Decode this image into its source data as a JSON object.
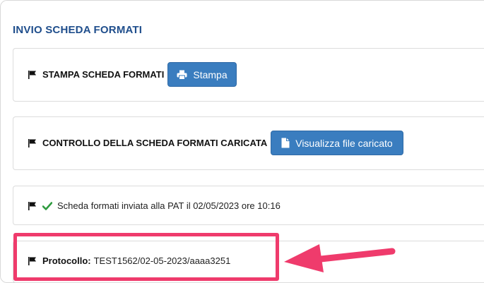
{
  "section": {
    "title": "INVIO SCHEDA FORMATI"
  },
  "rows": [
    {
      "label": "STAMPA SCHEDA FORMATI",
      "button_label": "Stampa"
    },
    {
      "label": "CONTROLLO DELLA SCHEDA FORMATI CARICATA",
      "button_label": "Visualizza file caricato"
    },
    {
      "status_text": "Scheda formati inviata alla PAT il 02/05/2023 ore 10:16"
    },
    {
      "label": "Protocollo:",
      "value": "TEST1562/02-05-2023/aaaa3251"
    }
  ],
  "colors": {
    "title": "#1f4e8c",
    "button": "#3a7dbf",
    "check": "#2e9b3f",
    "annotation": "#ef3b6c"
  },
  "icons": [
    "flag-icon",
    "print-icon",
    "file-icon",
    "check-icon"
  ]
}
